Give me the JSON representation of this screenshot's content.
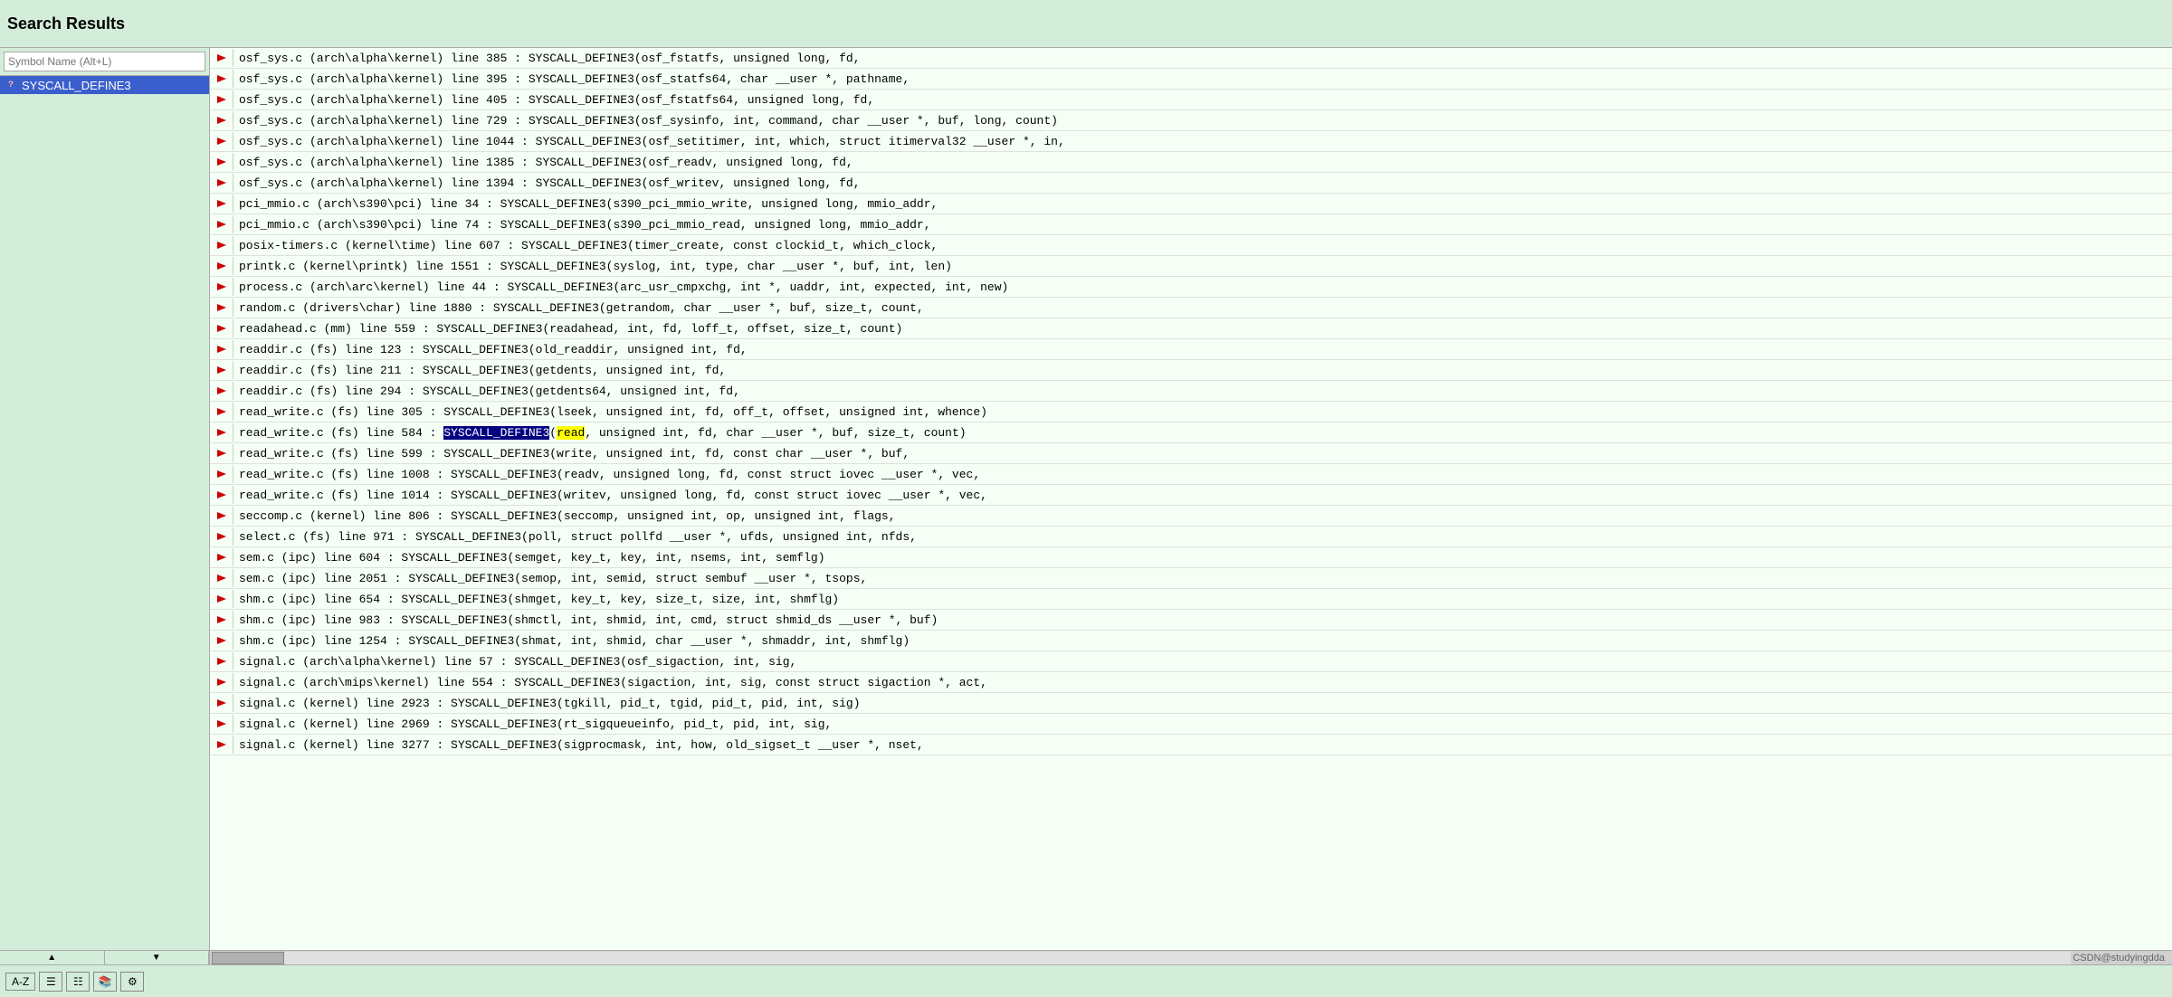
{
  "header": {
    "title": "Search Results"
  },
  "sidebar": {
    "search_placeholder": "Symbol Name (Alt+L)",
    "selected_item": "SYSCALL_DEFINE3",
    "items": [
      {
        "label": "SYSCALL_DEFINE3",
        "selected": true
      }
    ],
    "scroll_up_label": "▲",
    "scroll_down_label": "▼"
  },
  "toolbar": {
    "az_label": "A-Z",
    "btn1_label": "📋",
    "btn2_label": "🔲",
    "btn3_label": "📖",
    "btn4_label": "⚙"
  },
  "watermark": "CSDN@studyingdda",
  "results": [
    {
      "text": "osf_sys.c (arch\\alpha\\kernel) line 385 : SYSCALL_DEFINE3(osf_fstatfs, unsigned long, fd,"
    },
    {
      "text": "osf_sys.c (arch\\alpha\\kernel) line 395 : SYSCALL_DEFINE3(osf_statfs64, char __user *, pathname,"
    },
    {
      "text": "osf_sys.c (arch\\alpha\\kernel) line 405 : SYSCALL_DEFINE3(osf_fstatfs64, unsigned long, fd,"
    },
    {
      "text": "osf_sys.c (arch\\alpha\\kernel) line 729 : SYSCALL_DEFINE3(osf_sysinfo, int, command, char __user *, buf, long, count)"
    },
    {
      "text": "osf_sys.c (arch\\alpha\\kernel) line 1044 : SYSCALL_DEFINE3(osf_setitimer, int, which, struct itimerval32 __user *, in,"
    },
    {
      "text": "osf_sys.c (arch\\alpha\\kernel) line 1385 : SYSCALL_DEFINE3(osf_readv, unsigned long, fd,"
    },
    {
      "text": "osf_sys.c (arch\\alpha\\kernel) line 1394 : SYSCALL_DEFINE3(osf_writev, unsigned long, fd,"
    },
    {
      "text": "pci_mmio.c (arch\\s390\\pci) line 34 : SYSCALL_DEFINE3(s390_pci_mmio_write, unsigned long, mmio_addr,"
    },
    {
      "text": "pci_mmio.c (arch\\s390\\pci) line 74 : SYSCALL_DEFINE3(s390_pci_mmio_read, unsigned long, mmio_addr,"
    },
    {
      "text": "posix-timers.c (kernel\\time) line 607 : SYSCALL_DEFINE3(timer_create, const clockid_t, which_clock,"
    },
    {
      "text": "printk.c (kernel\\printk) line 1551 : SYSCALL_DEFINE3(syslog, int, type, char __user *, buf, int, len)"
    },
    {
      "text": "process.c (arch\\arc\\kernel) line 44 : SYSCALL_DEFINE3(arc_usr_cmpxchg, int *, uaddr, int, expected, int, new)"
    },
    {
      "text": "random.c (drivers\\char) line 1880 : SYSCALL_DEFINE3(getrandom, char __user *, buf, size_t, count,"
    },
    {
      "text": "readahead.c (mm) line 559 : SYSCALL_DEFINE3(readahead, int, fd, loff_t, offset, size_t, count)"
    },
    {
      "text": "readdir.c (fs) line 123 : SYSCALL_DEFINE3(old_readdir, unsigned int, fd,"
    },
    {
      "text": "readdir.c (fs) line 211 : SYSCALL_DEFINE3(getdents, unsigned int, fd,"
    },
    {
      "text": "readdir.c (fs) line 294 : SYSCALL_DEFINE3(getdents64, unsigned int, fd,"
    },
    {
      "text": "read_write.c (fs) line 305 : SYSCALL_DEFINE3(lseek, unsigned int, fd, off_t, offset, unsigned int, whence)"
    },
    {
      "text": "read_write.c (fs) line 584 : SYSCALL_DEFINE3(read, unsigned int, fd, char __user *, buf, size_t, count)",
      "highlight": true
    },
    {
      "text": "read_write.c (fs) line 599 : SYSCALL_DEFINE3(write, unsigned int, fd, const char __user *, buf,"
    },
    {
      "text": "read_write.c (fs) line 1008 : SYSCALL_DEFINE3(readv, unsigned long, fd, const struct iovec __user *, vec,"
    },
    {
      "text": "read_write.c (fs) line 1014 : SYSCALL_DEFINE3(writev, unsigned long, fd, const struct iovec __user *, vec,"
    },
    {
      "text": "seccomp.c (kernel) line 806 : SYSCALL_DEFINE3(seccomp, unsigned int, op, unsigned int, flags,"
    },
    {
      "text": "select.c (fs) line 971 : SYSCALL_DEFINE3(poll, struct pollfd __user *, ufds, unsigned int, nfds,"
    },
    {
      "text": "sem.c (ipc) line 604 : SYSCALL_DEFINE3(semget, key_t, key, int, nsems, int, semflg)"
    },
    {
      "text": "sem.c (ipc) line 2051 : SYSCALL_DEFINE3(semop, int, semid, struct sembuf __user *, tsops,"
    },
    {
      "text": "shm.c (ipc) line 654 : SYSCALL_DEFINE3(shmget, key_t, key, size_t, size, int, shmflg)"
    },
    {
      "text": "shm.c (ipc) line 983 : SYSCALL_DEFINE3(shmctl, int, shmid, int, cmd, struct shmid_ds __user *, buf)"
    },
    {
      "text": "shm.c (ipc) line 1254 : SYSCALL_DEFINE3(shmat, int, shmid, char __user *, shmaddr, int, shmflg)"
    },
    {
      "text": "signal.c (arch\\alpha\\kernel) line 57 : SYSCALL_DEFINE3(osf_sigaction, int, sig,"
    },
    {
      "text": "signal.c (arch\\mips\\kernel) line 554 : SYSCALL_DEFINE3(sigaction, int, sig, const struct sigaction *, act,"
    },
    {
      "text": "signal.c (kernel) line 2923 : SYSCALL_DEFINE3(tgkill, pid_t, tgid, pid_t, pid, int, sig)"
    },
    {
      "text": "signal.c (kernel) line 2969 : SYSCALL_DEFINE3(rt_sigqueueinfo, pid_t, pid, int, sig,"
    },
    {
      "text": "signal.c (kernel) line 3277 : SYSCALL_DEFINE3(sigprocmask, int, how, old_sigset_t __user *, nset,"
    }
  ]
}
